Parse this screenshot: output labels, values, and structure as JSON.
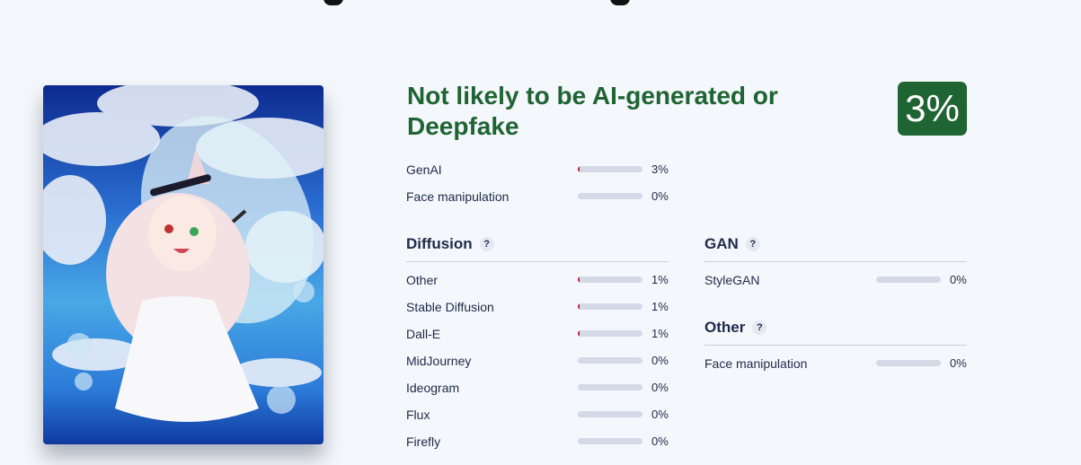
{
  "verdict": {
    "title": "Not likely to be AI-generated or Deepfake",
    "score": "3%"
  },
  "summary": [
    {
      "label": "GenAI",
      "value": "3%",
      "fraction": 0.03
    },
    {
      "label": "Face manipulation",
      "value": "0%",
      "fraction": 0
    }
  ],
  "diffusion": {
    "heading": "Diffusion",
    "help": "?",
    "items": [
      {
        "label": "Other",
        "value": "1%",
        "fraction": 0.01
      },
      {
        "label": "Stable Diffusion",
        "value": "1%",
        "fraction": 0.01
      },
      {
        "label": "Dall-E",
        "value": "1%",
        "fraction": 0.01
      },
      {
        "label": "MidJourney",
        "value": "0%",
        "fraction": 0
      },
      {
        "label": "Ideogram",
        "value": "0%",
        "fraction": 0
      },
      {
        "label": "Flux",
        "value": "0%",
        "fraction": 0
      },
      {
        "label": "Firefly",
        "value": "0%",
        "fraction": 0
      }
    ]
  },
  "gan": {
    "heading": "GAN",
    "help": "?",
    "items": [
      {
        "label": "StyleGAN",
        "value": "0%",
        "fraction": 0
      }
    ]
  },
  "other": {
    "heading": "Other",
    "help": "?",
    "items": [
      {
        "label": "Face manipulation",
        "value": "0%",
        "fraction": 0
      }
    ]
  },
  "colors": {
    "verdict_green": "#1f6433",
    "bar_track": "#d3d9e6",
    "bar_fill": "#c0143c"
  }
}
